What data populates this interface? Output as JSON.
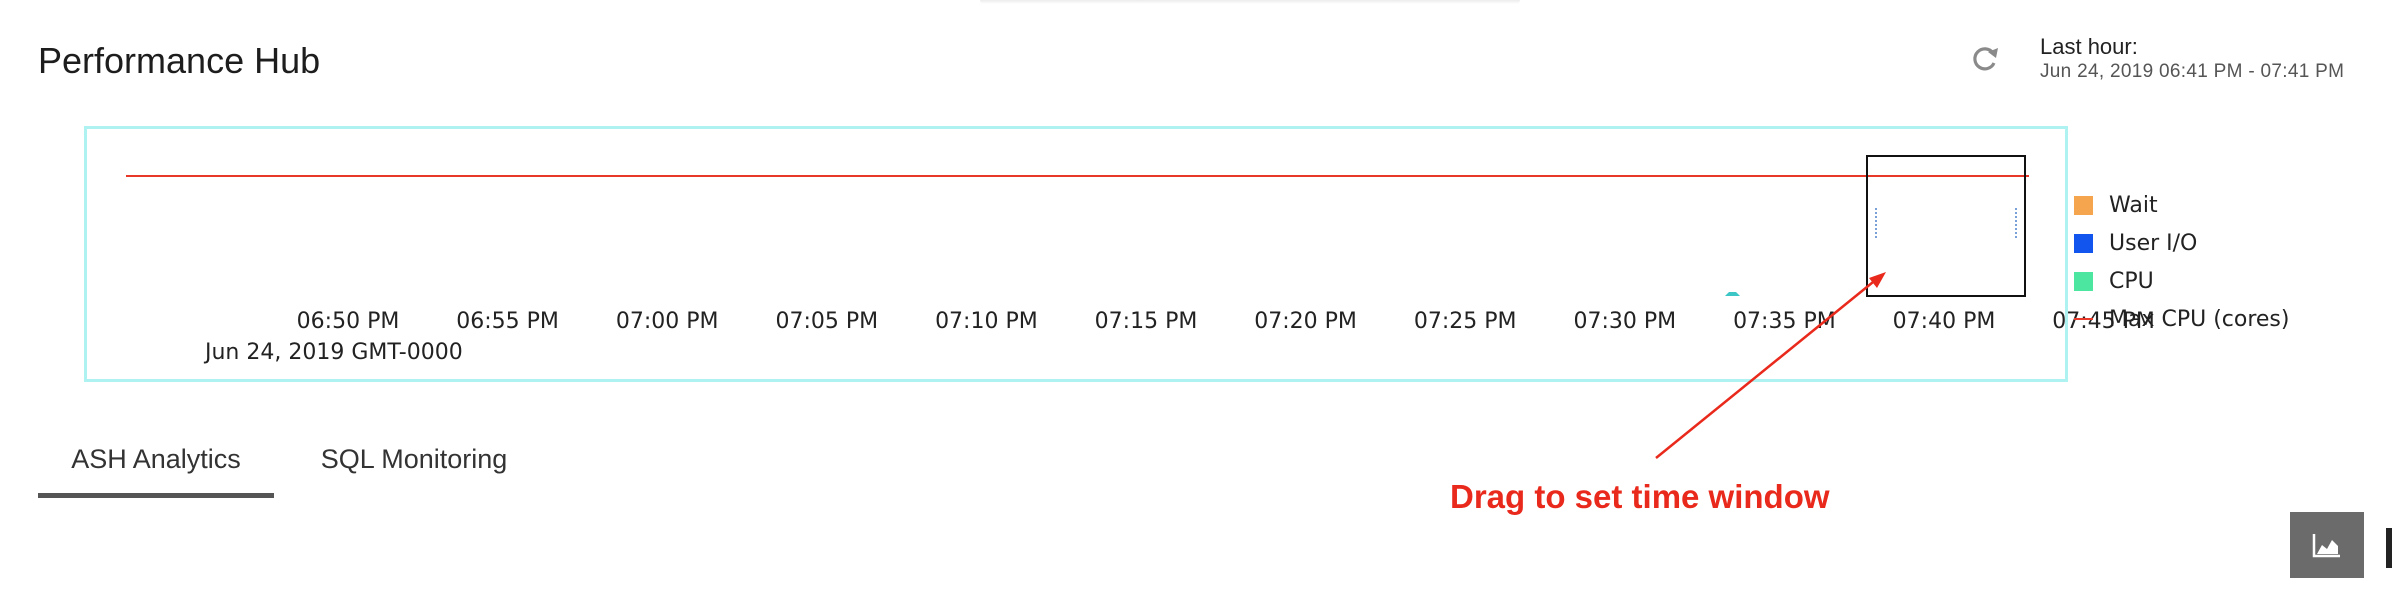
{
  "header": {
    "title": "Performance Hub",
    "refresh_icon": "refresh-icon",
    "time_caption": "Last hour:",
    "time_range": "Jun 24, 2019 06:41 PM - 07:41 PM"
  },
  "chart_data": {
    "type": "area",
    "x_ticks": [
      "06:50 PM",
      "06:55 PM",
      "07:00 PM",
      "07:05 PM",
      "07:10 PM",
      "07:15 PM",
      "07:20 PM",
      "07:25 PM",
      "07:30 PM",
      "07:35 PM",
      "07:40 PM",
      "07:45 PM"
    ],
    "x_sublabel": "Jun 24, 2019 GMT-0000",
    "series": [
      {
        "name": "Wait",
        "color": "#f5a54d"
      },
      {
        "name": "User I/O",
        "color": "#1155ee"
      },
      {
        "name": "CPU",
        "color": "#4de6a0"
      },
      {
        "name": "Max CPU (cores)",
        "color": "#e8382a"
      }
    ],
    "max_cpu_line": true,
    "selection_window": {
      "start": "07:40 PM",
      "end": "07:45 PM"
    }
  },
  "tabs": [
    {
      "label": "ASH Analytics",
      "active": true
    },
    {
      "label": "SQL Monitoring",
      "active": false
    }
  ],
  "annotation": {
    "text": "Drag to set time window",
    "color": "#e9291b"
  },
  "chart_type_button": {
    "icon": "area-chart-icon"
  }
}
